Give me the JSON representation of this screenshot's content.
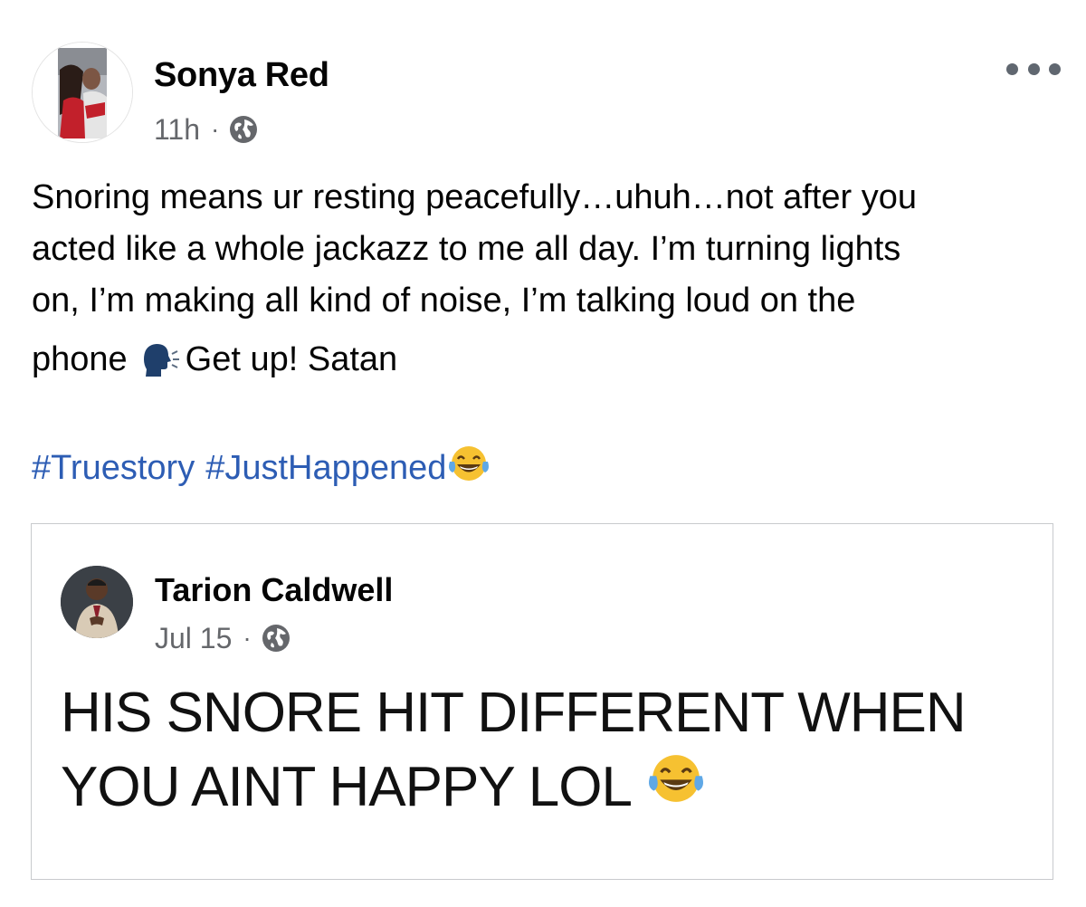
{
  "post": {
    "author_name": "Sonya Red",
    "timestamp": "11h",
    "separator": "·",
    "privacy_icon": "globe-icon",
    "more_icon": "more-options-icon",
    "text": {
      "line1": "Snoring means ur resting peacefully…uhuh…not after you",
      "line2": "acted like a whole jackazz to me all day.  I’m turning lights",
      "line3": "on, I’m making all kind of noise, I’m talking loud on the",
      "line4_before": "phone",
      "line4_emoji": "speaking-head-emoji",
      "line4_after": "Get up! Satan"
    },
    "hashtags": [
      "#Truestory",
      "#JustHappened"
    ],
    "hashtag_emoji": "tears-of-joy-emoji"
  },
  "shared_post": {
    "author_name": "Tarion Caldwell",
    "date": "Jul 15",
    "separator": "·",
    "privacy_icon": "globe-icon",
    "text_line1": "HIS SNORE HIT DIFFERENT WHEN",
    "text_line2": "YOU AINT HAPPY LOL",
    "text_emoji": "tears-of-joy-emoji"
  },
  "colors": {
    "text": "#050505",
    "meta": "#65676b",
    "hashtag": "#2d5db4",
    "border": "#c8cacd",
    "emoji_yellow": "#f6c131"
  }
}
